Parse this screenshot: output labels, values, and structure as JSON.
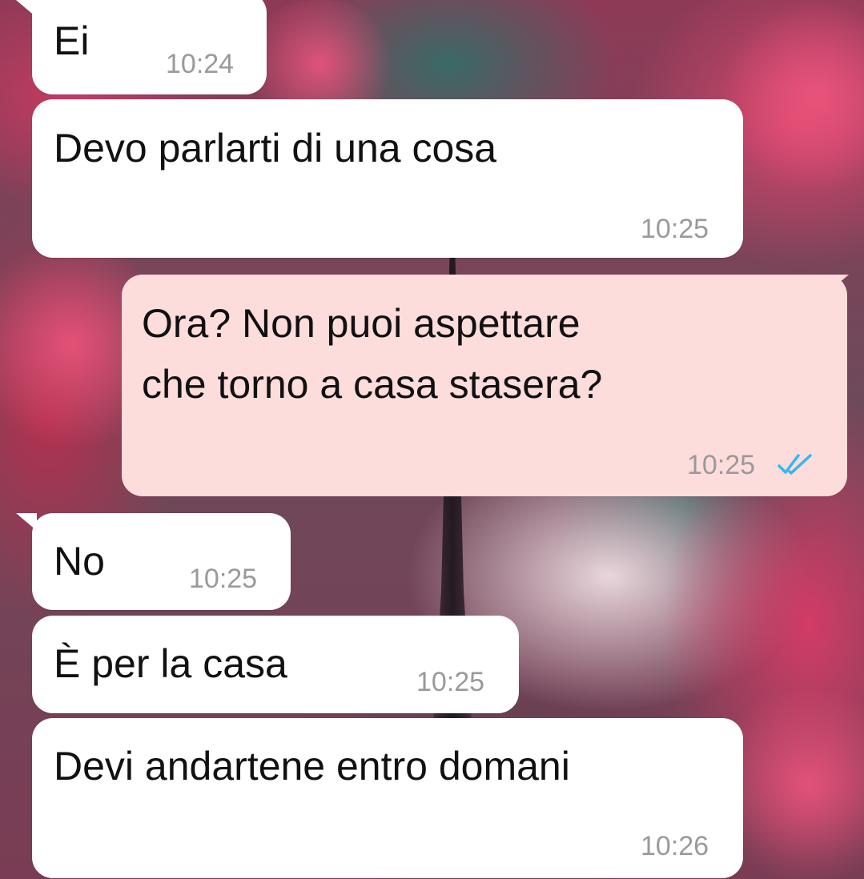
{
  "messages": [
    {
      "direction": "incoming",
      "text": "Ei",
      "time": "10:24"
    },
    {
      "direction": "incoming",
      "text": "Devo parlarti di una cosa",
      "time": "10:25"
    },
    {
      "direction": "outgoing",
      "text_lines": [
        "Ora? Non puoi aspettare",
        "che torno a casa stasera?"
      ],
      "time": "10:25",
      "status_icon": "double-check-read-icon"
    },
    {
      "direction": "incoming",
      "text": "No",
      "time": "10:25"
    },
    {
      "direction": "incoming",
      "text": "È per la casa",
      "time": "10:25"
    },
    {
      "direction": "incoming",
      "text": "Devi andartene entro domani",
      "time": "10:26"
    }
  ],
  "colors": {
    "incoming_bubble": "#ffffff",
    "outgoing_bubble": "#fddcdc",
    "timestamp": "#9a9a9a",
    "read_ticks": "#34b7f1"
  }
}
